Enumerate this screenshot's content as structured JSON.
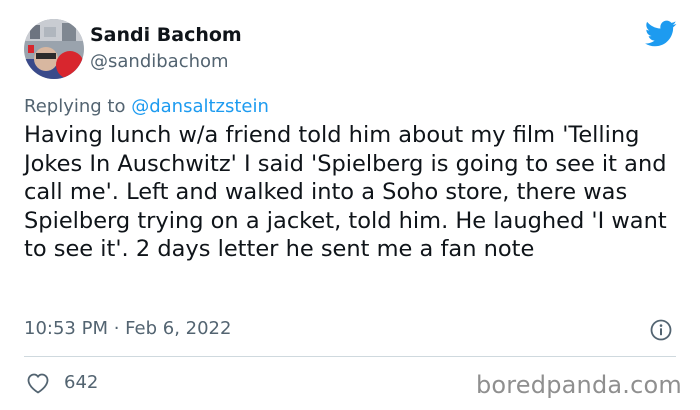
{
  "user": {
    "display_name": "Sandi Bachom",
    "handle": "@sandibachom"
  },
  "reply": {
    "prefix": "Replying to ",
    "mention": "@dansaltzstein"
  },
  "tweet": {
    "text": "Having lunch w/a friend told him about my film 'Telling Jokes In Auschwitz' I said 'Spielberg is going to see it and call me'. Left and walked into a Soho store, there was Spielberg trying on a jacket, told him. He laughed 'I want to see it'. 2 days letter he sent me a fan note",
    "timestamp": "10:53 PM · Feb 6, 2022",
    "likes": "642"
  },
  "icons": {
    "brand": "twitter-bird-icon",
    "info": "info-icon",
    "like": "heart-icon"
  },
  "colors": {
    "twitter_blue": "#1d9bf0",
    "text_primary": "#0f1419",
    "text_secondary": "#536471"
  },
  "watermark": "boredpanda.com"
}
